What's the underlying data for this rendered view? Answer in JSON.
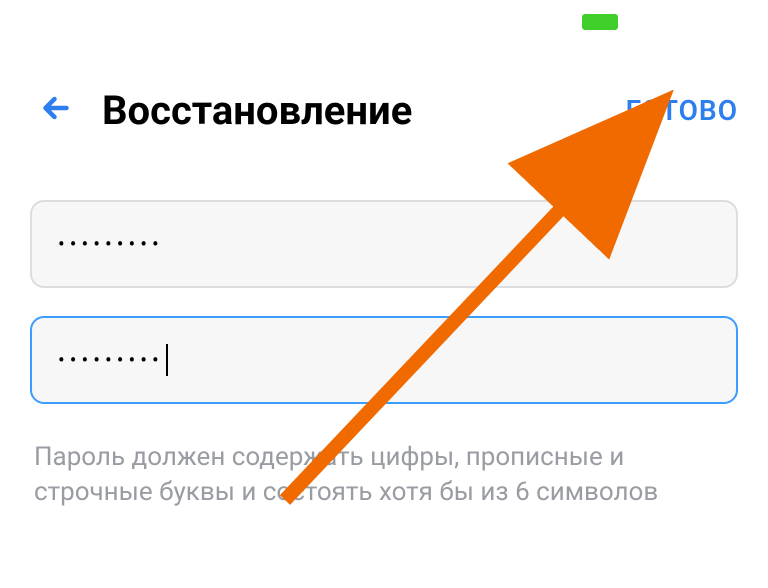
{
  "header": {
    "title": "Восстановление",
    "done_label": "ГОТОВО"
  },
  "form": {
    "password1_mask": "•••••••••",
    "password2_mask": "•••••••••",
    "hint": "Пароль должен содержать цифры, прописные и строчные буквы и состоять хотя бы из 6 символов"
  },
  "colors": {
    "accent": "#2d7ff0",
    "battery": "#3fce2a",
    "focus_border": "#3a9dff",
    "hint_text": "#9a9ca3",
    "annotation": "#f06a00"
  }
}
